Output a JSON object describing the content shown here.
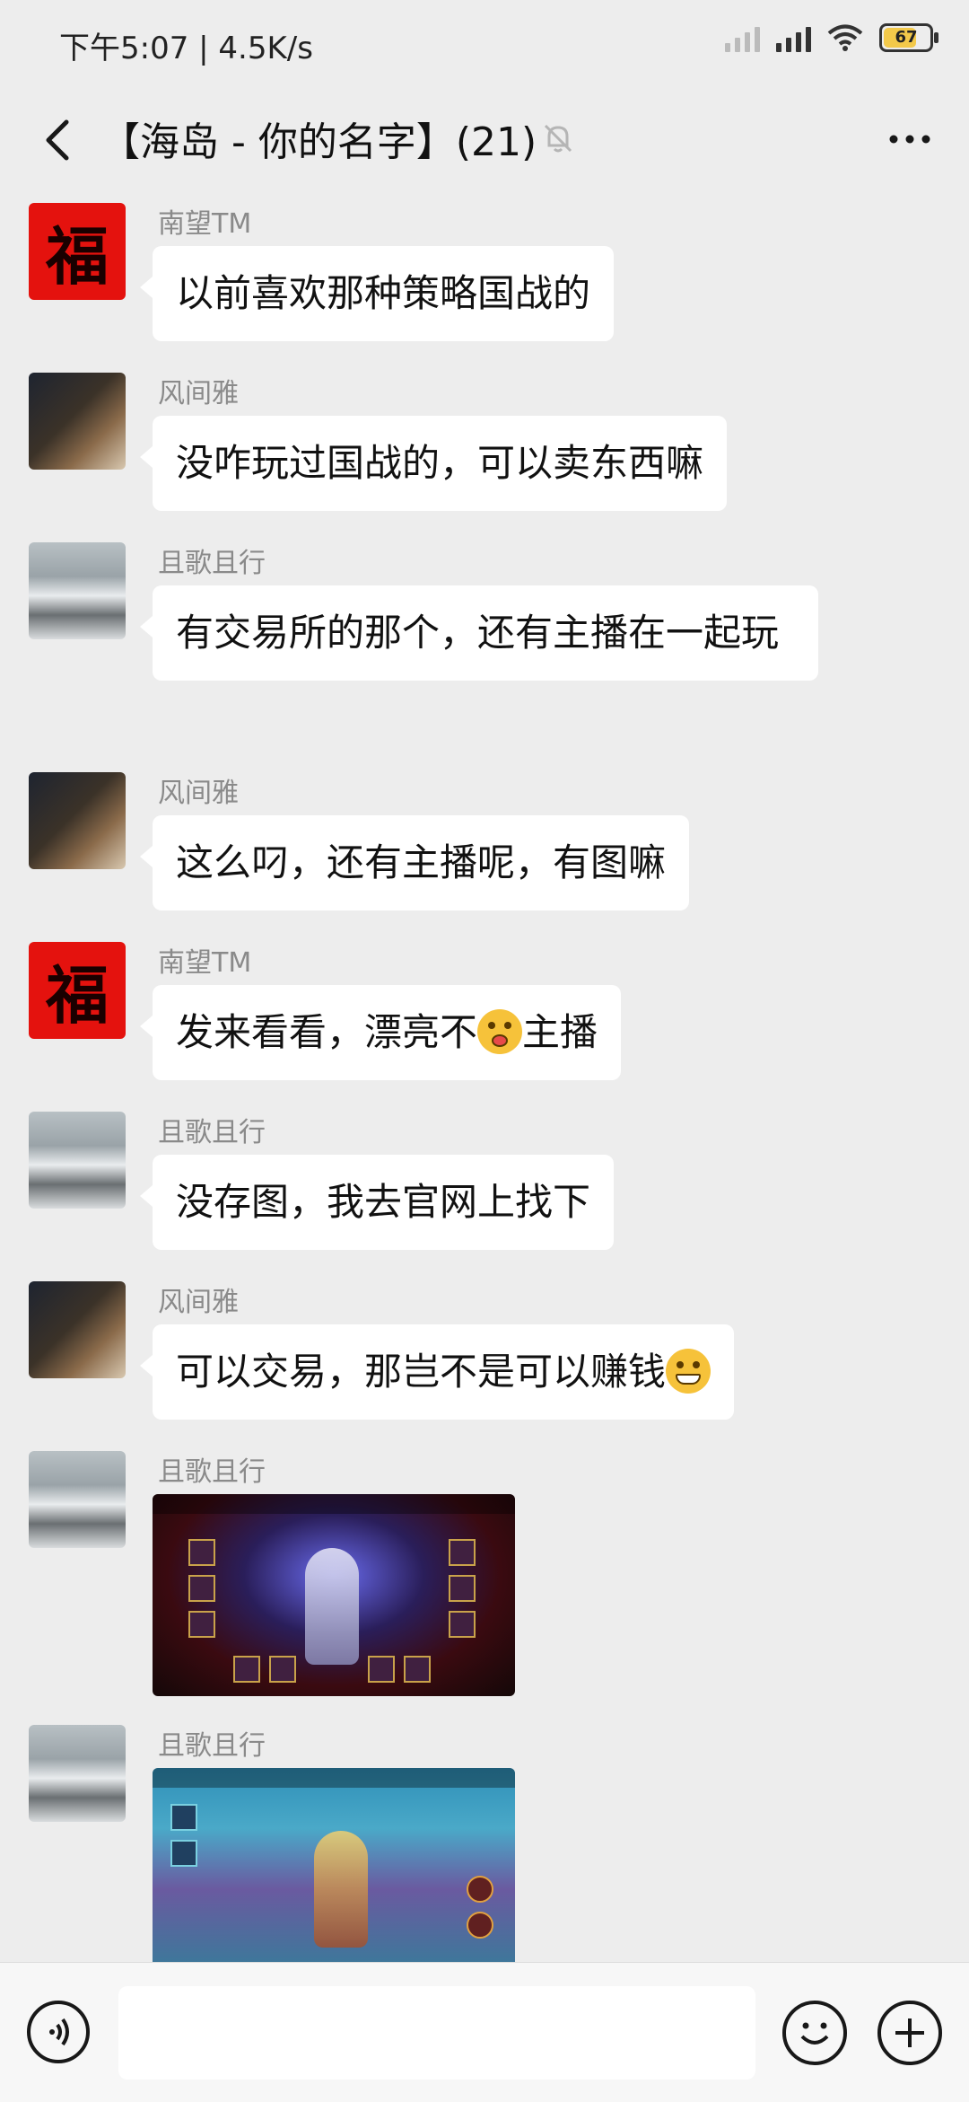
{
  "status_bar": {
    "time": "下午5:07 | 4.5K/s",
    "battery": "67"
  },
  "header": {
    "title": "【海岛 - 你的名字】(21)"
  },
  "messages": [
    {
      "sender": "南望TM",
      "avatar": "fu-character-avatar",
      "text": "以前喜欢那种策略国战的"
    },
    {
      "sender": "风间雅",
      "avatar": "person-eating-avatar",
      "text": "没咋玩过国战的，可以卖东西嘛"
    },
    {
      "sender": "且歌且行",
      "avatar": "snowy-landscape-avatar",
      "text": "有交易所的那个，还有主播在一起玩"
    },
    {
      "sender": "风间雅",
      "avatar": "person-eating-avatar",
      "text": "这么叼，还有主播呢，有图嘛"
    },
    {
      "sender": "南望TM",
      "avatar": "fu-character-avatar",
      "text_before": "发来看看，漂亮不",
      "emoji": "drooling-face-emoji",
      "text_after": "主播"
    },
    {
      "sender": "且歌且行",
      "avatar": "snowy-landscape-avatar",
      "text": "没存图，我去官网上找下"
    },
    {
      "sender": "风间雅",
      "avatar": "person-eating-avatar",
      "text": "可以交易，那岂不是可以赚钱",
      "emoji": "grinning-emoji"
    },
    {
      "sender": "且歌且行",
      "avatar": "snowy-landscape-avatar",
      "image": "game-character-screenshot"
    },
    {
      "sender": "且歌且行",
      "avatar": "snowy-landscape-avatar",
      "image": "game-battle-screenshot"
    }
  ],
  "input_bar": {
    "placeholder": ""
  },
  "colors": {
    "background": "#ededed",
    "bubble": "#ffffff",
    "sender_name": "#8a8a8a"
  }
}
